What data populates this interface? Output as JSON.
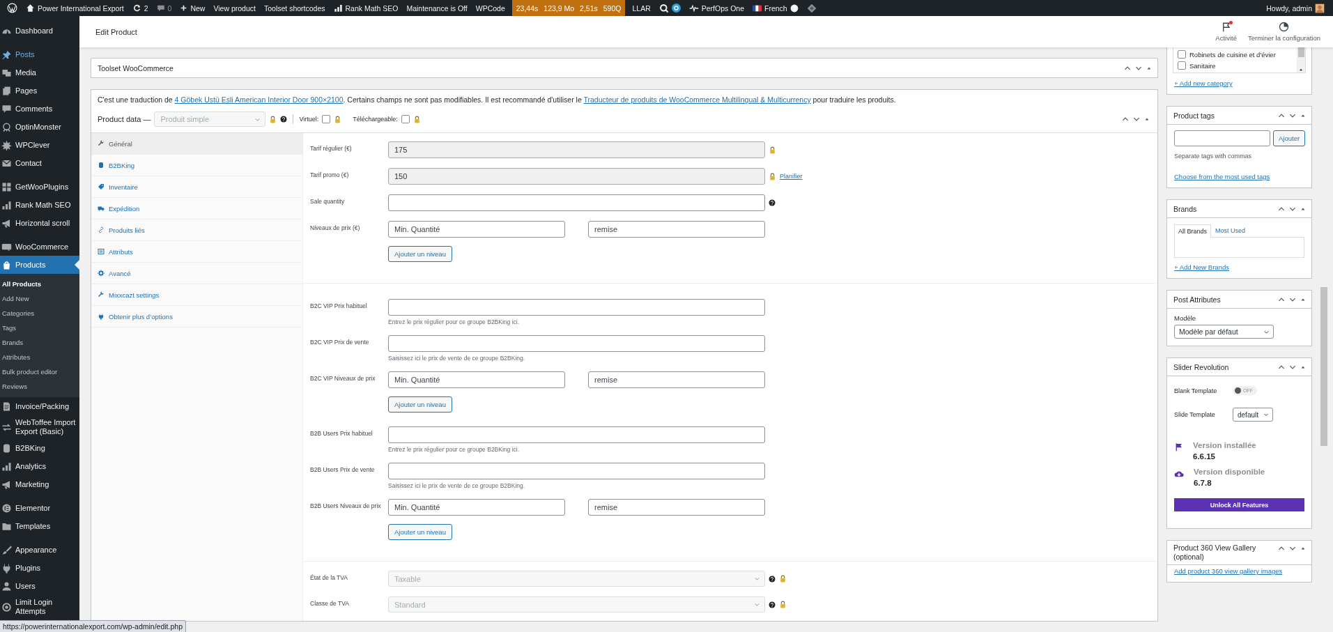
{
  "admin_bar": {
    "site": "Power International Export",
    "updates": "2",
    "comments": "0",
    "new": "New",
    "links": [
      "View product",
      "Toolset shortcodes"
    ],
    "rank_math": "Rank Math SEO",
    "maintenance": "Maintenance is Off",
    "wpcode": "WPCode",
    "perf": [
      "23,44s",
      "123,9 Mo",
      "2,51s",
      "590Q"
    ],
    "llar": "LLAR",
    "perfops": "PerfOps One",
    "language": "French",
    "account": "Howdy, admin"
  },
  "header": {
    "title": "Edit Product",
    "actions": [
      {
        "label": "Activité",
        "unread": true
      },
      {
        "label": "Terminer la configuration",
        "unread": false
      }
    ]
  },
  "sidebar": {
    "groups": [
      {
        "items": [
          {
            "label": "Dashboard",
            "selected": false,
            "hovered": false
          }
        ]
      },
      {
        "items": [
          {
            "label": "Posts",
            "selected": false,
            "hovered": true
          },
          {
            "label": "Media",
            "selected": false,
            "hovered": false
          },
          {
            "label": "Pages",
            "selected": false,
            "hovered": false
          },
          {
            "label": "Comments",
            "selected": false,
            "hovered": false
          },
          {
            "label": "OptinMonster",
            "selected": false,
            "hovered": false
          },
          {
            "label": "WPClever",
            "selected": false,
            "hovered": false
          },
          {
            "label": "Contact",
            "selected": false,
            "hovered": false
          }
        ]
      },
      {
        "items": [
          {
            "label": "GetWooPlugins",
            "selected": false,
            "hovered": false
          },
          {
            "label": "Rank Math SEO",
            "selected": false,
            "hovered": false
          },
          {
            "label": "Horizontal scroll",
            "selected": false,
            "hovered": false
          }
        ]
      },
      {
        "items": [
          {
            "label": "WooCommerce",
            "selected": false,
            "hovered": false
          },
          {
            "label": "Products",
            "selected": true,
            "hovered": false,
            "children": [
              {
                "label": "All Products",
                "selected": true
              },
              {
                "label": "Add New",
                "selected": false
              },
              {
                "label": "Categories",
                "selected": false
              },
              {
                "label": "Tags",
                "selected": false
              },
              {
                "label": "Brands",
                "selected": false
              },
              {
                "label": "Attributes",
                "selected": false
              },
              {
                "label": "Bulk product editor",
                "selected": false
              },
              {
                "label": "Reviews",
                "selected": false
              }
            ]
          },
          {
            "label": "Invoice/Packing",
            "selected": false,
            "hovered": false
          },
          {
            "label": "WebToffee Import Export (Basic)",
            "selected": false,
            "hovered": false
          },
          {
            "label": "B2BKing",
            "selected": false,
            "hovered": false
          },
          {
            "label": "Analytics",
            "selected": false,
            "hovered": false
          },
          {
            "label": "Marketing",
            "selected": false,
            "hovered": false
          }
        ]
      },
      {
        "items": [
          {
            "label": "Elementor",
            "selected": false,
            "hovered": false
          },
          {
            "label": "Templates",
            "selected": false,
            "hovered": false
          }
        ]
      },
      {
        "items": [
          {
            "label": "Appearance",
            "selected": false,
            "hovered": false
          },
          {
            "label": "Plugins",
            "selected": false,
            "hovered": false
          },
          {
            "label": "Users",
            "selected": false,
            "hovered": false
          },
          {
            "label": "Limit Login Attempts",
            "selected": false,
            "hovered": false
          }
        ]
      }
    ]
  },
  "toolset_box": {
    "title": "Toolset WooCommerce"
  },
  "product_data": {
    "notice": [
      {
        "kind": "text",
        "text": "C'est une traduction de "
      },
      {
        "kind": "link",
        "text": "4 Göbek Ustü Esli American Interior Door 900×2100"
      },
      {
        "kind": "text",
        "text": ". Certains champs ne sont pas modifiables. Il est recommandé d'utiliser le "
      },
      {
        "kind": "link",
        "text": "Traducteur de produits de WooCommerce Multilingual & Multicurrency"
      },
      {
        "kind": "text",
        "text": " pour traduire les produits."
      }
    ],
    "label": "Product data —",
    "type_select": {
      "value": "Produit simple",
      "disabled": true
    },
    "checkboxes": [
      {
        "label": "Virtuel:",
        "checked": false
      },
      {
        "label": "Téléchargeable:",
        "checked": false
      }
    ],
    "tabs": [
      {
        "label": "Général",
        "selected": true
      },
      {
        "label": "B2BKing",
        "selected": false
      },
      {
        "label": "Inventaire",
        "selected": false
      },
      {
        "label": "Expédition",
        "selected": false
      },
      {
        "label": "Produits liés",
        "selected": false
      },
      {
        "label": "Attributs",
        "selected": false
      },
      {
        "label": "Avancé",
        "selected": false
      },
      {
        "label": "Mixxcazt settings",
        "selected": false
      },
      {
        "label": "Obtenir plus d’options",
        "selected": false
      }
    ],
    "sections": [
      [
        {
          "kind": "input",
          "label": "Tarif régulier (€)",
          "value": "175",
          "disabled": true,
          "locked": true
        },
        {
          "kind": "input",
          "label": "Tarif promo (€)",
          "value": "150",
          "disabled": true,
          "locked": true,
          "link": "Planifier"
        },
        {
          "kind": "input",
          "label": "Sale quantity",
          "help": true
        },
        {
          "kind": "tiers",
          "label": "Niveaux de prix (€)",
          "placeholders": [
            "Min. Quantité",
            "remise"
          ],
          "button": "Ajouter un niveau"
        }
      ],
      [
        {
          "kind": "input",
          "label": "B2C VIP Prix habituel",
          "hint": "Entrez le prix régulier pour ce groupe B2BKing ici."
        },
        {
          "kind": "input",
          "label": "B2C VIP Prix de vente",
          "hint": "Saisissez ici le prix de vente de ce groupe B2BKing."
        },
        {
          "kind": "tiers",
          "label": "B2C VIP Niveaux de prix",
          "placeholders": [
            "Min. Quantité",
            "remise"
          ],
          "button": "Ajouter un niveau"
        },
        {
          "kind": "input",
          "label": "B2B Users Prix habituel",
          "hint": "Entrez le prix régulier pour ce groupe B2BKing ici."
        },
        {
          "kind": "input",
          "label": "B2B Users Prix de vente",
          "hint": "Saisissez ici le prix de vente de ce groupe B2BKing."
        },
        {
          "kind": "tiers",
          "label": "B2B Users Niveaux de prix",
          "placeholders": [
            "Min. Quantité",
            "remise"
          ],
          "button": "Ajouter un niveau"
        }
      ],
      [
        {
          "kind": "select",
          "label": "État de la TVA",
          "value": "Taxable",
          "disabled": true,
          "help": true,
          "locked": true
        },
        {
          "kind": "select",
          "label": "Classe de TVA",
          "value": "Standard",
          "disabled": true,
          "help": true,
          "locked": true
        }
      ]
    ]
  },
  "side_boxes": [
    {
      "kind": "categories",
      "items": [
        {
          "label": "Robinets de cuisine et d'évier",
          "checked": false
        },
        {
          "label": "Sanitaire",
          "checked": false
        }
      ],
      "link": "+ Add new category"
    },
    {
      "kind": "tags",
      "title": "Product tags",
      "button": "Ajouter",
      "hint": "Separate tags with commas",
      "link": "Choose from the most used tags"
    },
    {
      "kind": "brands",
      "title": "Brands",
      "tabs": [
        {
          "label": "All Brands",
          "selected": true
        },
        {
          "label": "Most Used",
          "selected": false
        }
      ],
      "link": "+ Add New Brands"
    },
    {
      "kind": "attributes",
      "title": "Post Attributes",
      "label": "Modèle",
      "select": "Modèle par défaut"
    },
    {
      "kind": "slider",
      "title": "Slider Revolution",
      "toggle": {
        "label": "Blank Template",
        "text": "OFF",
        "on": false
      },
      "template": {
        "label": "Slide Template",
        "value": "default"
      },
      "versions": [
        {
          "label": "Version installée",
          "value": "6.6.15"
        },
        {
          "label": "Version disponible",
          "value": "6.7.8"
        }
      ],
      "button": "Unlock All Features"
    },
    {
      "kind": "gallery",
      "title": "Product 360 View Gallery (optional)",
      "link": "Add product 360 view gallery images"
    }
  ],
  "status_bar": {
    "url": "https://powerinternationalexport.com/wp-admin/edit.php"
  }
}
